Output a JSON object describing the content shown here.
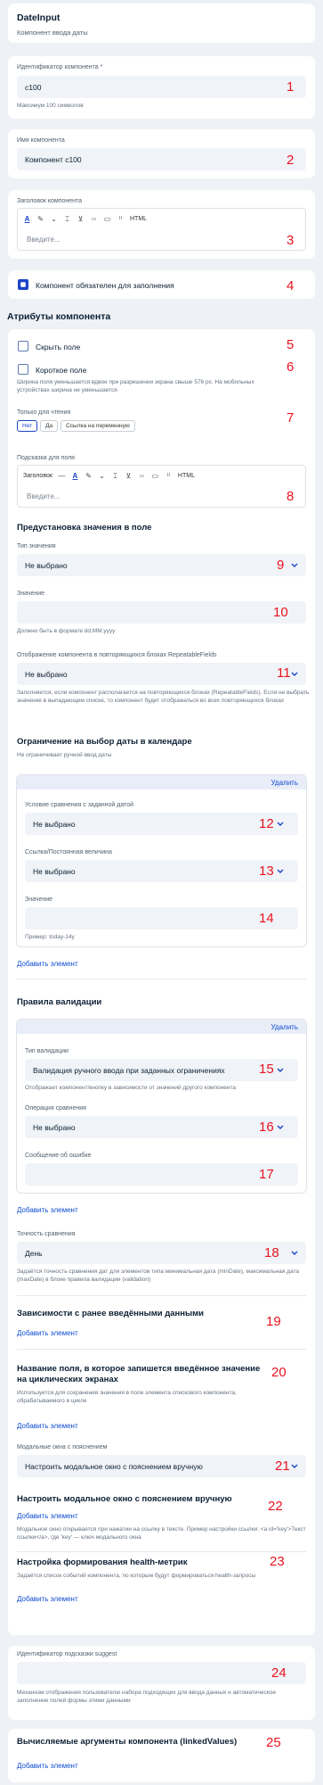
{
  "header": {
    "title": "DateInput",
    "subtitle": "Компонент ввода даты"
  },
  "component_id": {
    "label": "Идентификатор компонента *",
    "value": "c100",
    "hint": "Максимум 100 символов",
    "marker": "1"
  },
  "component_name": {
    "label": "Имя компонента",
    "value": "Компонент c100",
    "marker": "2"
  },
  "component_header": {
    "label": "Заголовок компонента",
    "placeholder": "Введите...",
    "html_label": "HTML",
    "marker": "3"
  },
  "required": {
    "label": "Компонент обязателен для заполнения",
    "checked": true,
    "marker": "4"
  },
  "attributes": {
    "title": "Атрибуты компонента",
    "hide_field": {
      "label": "Скрыть поле",
      "marker": "5"
    },
    "short_field": {
      "label": "Короткое поле",
      "marker": "6",
      "hint": "Ширина поля уменьшается вдвое при разрешении экрана свыше 576 px. На мобильных устройствах ширина не уменьшается"
    },
    "readonly": {
      "label": "Только для чтения",
      "options": [
        "Нет",
        "Да",
        "Ссылка на переменную"
      ],
      "selected": "Нет",
      "marker": "7"
    },
    "tooltip": {
      "label": "Подсказка для поля",
      "style_label": "Заголовок",
      "html_label": "HTML",
      "placeholder": "Введите...",
      "marker": "8"
    }
  },
  "preset": {
    "title": "Предустановка значения в поле",
    "value_type": {
      "label": "Тип значения",
      "value": "Не выбрано",
      "marker": "9"
    },
    "value": {
      "label": "Значение",
      "hint": "Должно быть в формате dd.MM.yyyy",
      "marker": "10"
    },
    "repeatable": {
      "label": "Отображение компонента в повторяющихся блоках RepeatableFields",
      "value": "Не выбрано",
      "marker": "11",
      "hint": "Заполняется, если компонент располагается на повторяющихся блоках (RepeatableFields). Если не выбрать значение в выпадающем списке, то компонент будет отображаться во всех повторяющихся блоках"
    }
  },
  "calendar_limit": {
    "title": "Ограничение на выбор даты в календаре",
    "subtitle": "Не ограничивает ручной ввод даты",
    "delete_label": "Удалить",
    "condition": {
      "label": "Условие сравнения с заданной датой",
      "value": "Не выбрано",
      "marker": "12"
    },
    "reference": {
      "label": "Ссылка/Постоянная величина",
      "value": "Не выбрано",
      "marker": "13"
    },
    "value": {
      "label": "Значение",
      "hint": "Пример: today-14y",
      "marker": "14"
    },
    "add_label": "Добавить элемент"
  },
  "validation": {
    "title": "Правила валидации",
    "delete_label": "Удалить",
    "type": {
      "label": "Тип валидации",
      "value": "Валидация ручного ввода при заданных ограничениях",
      "hint": "Отображает компонент/кнопку в зависимости от значений другого компонента",
      "marker": "15"
    },
    "operation": {
      "label": "Операция сравнения",
      "value": "Не выбрано",
      "marker": "16"
    },
    "error": {
      "label": "Сообщение об ошибке",
      "marker": "17"
    },
    "add_label": "Добавить элемент"
  },
  "precision": {
    "label": "Точность сравнения",
    "value": "День",
    "marker": "18",
    "hint": "Задаётся точность сравнения дат для элементов типа минимальная дата (minDate), максимальная дата (maxDate) в блоке правила валидации (validation)"
  },
  "dependencies": {
    "title": "Зависимости с ранее введёнными данными",
    "add_label": "Добавить элемент",
    "marker": "19"
  },
  "cycle_field": {
    "title": "Название поля, в которое запишется введённое значение на циклических экранах",
    "hint": "Используется для сохранения значения в поле элемента спискового компонента, обрабатываемого в цикле",
    "add_label": "Добавить элемент",
    "marker": "20"
  },
  "modals": {
    "label": "Модальные окна с пояснением",
    "value": "Настроить модальное окно с пояснением вручную",
    "marker": "21"
  },
  "manual_modal": {
    "title": "Настроить модальное окно с пояснением вручную",
    "add_label": "Добавить элемент",
    "hint": "Модальное окно открывается при нажатии на ссылку в тексте. Пример настройки ссылки: <a id='key'>Текст ссылки</a>, где 'key' — ключ модального окна",
    "marker": "22"
  },
  "health": {
    "title": "Настройка формирования health-метрик",
    "hint": "Задаётся список событий компонента, по которым будут формироваться health-запросы",
    "add_label": "Добавить элемент",
    "marker": "23"
  },
  "suggest": {
    "label": "Идентификатор подсказки suggest",
    "hint": "Механизм отображения пользователю набора подходящих для ввода данных и автоматическое заполнение полей формы этими данными",
    "marker": "24"
  },
  "linked": {
    "title": "Вычисляемые аргументы компонента (linkedValues)",
    "add_label": "Добавить элемент",
    "marker": "25"
  },
  "colors": {
    "accent": "#1a44c9",
    "link": "#0d4cd3",
    "marker": "#e8131f",
    "field_bg": "#f0f3f7",
    "page_bg": "#eef1f5"
  }
}
